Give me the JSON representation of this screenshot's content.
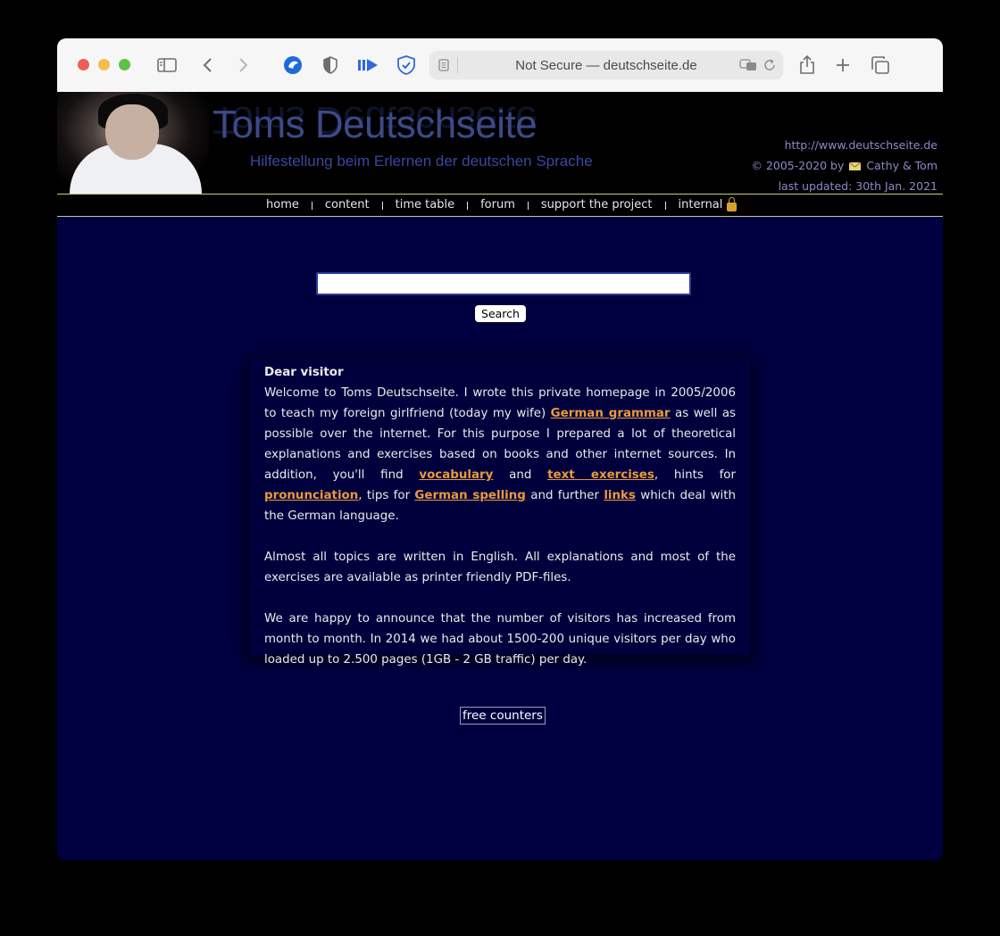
{
  "browser": {
    "address": "Not Secure — deutschseite.de",
    "traffic_lights": [
      "#ec5f56",
      "#f3bd4f",
      "#5ec245"
    ]
  },
  "header": {
    "title": "Toms Deutschseite",
    "subtitle": "Hilfestellung beim Erlernen der deutschen Sprache",
    "url": "http://www.deutschseite.de",
    "copyright_prefix": "© 2005-2020 by",
    "copyright_names": "Cathy & Tom",
    "last_updated": "last updated: 30th Jan. 2021"
  },
  "nav": {
    "items": [
      "home",
      "content",
      "time table",
      "forum",
      "support the project",
      "internal"
    ]
  },
  "search": {
    "value": "",
    "button_label": "Search"
  },
  "content": {
    "greeting": "Dear visitor",
    "p1": {
      "t1": "Welcome to Toms Deutschseite. I wrote this private homepage in 2005/2006 to teach my foreign girlfriend (today my wife) ",
      "link_grammar": "German grammar",
      "t2": " as well as possible over the internet. For this purpose I prepared a lot of theoretical explanations and exercises based on books and other internet sources. In addition, you'll find ",
      "link_vocabulary": "vocabulary",
      "t3": " and ",
      "link_text_exercises": "text exercises",
      "t4": ", hints for ",
      "link_pronunciation": "pronunciation",
      "t5": ", tips for ",
      "link_spelling": "German spelling",
      "t6": " and further ",
      "link_links": "links",
      "t7": " which deal with the German language."
    },
    "p2": "Almost all topics are written in English. All explanations and most of the exercises are available as printer friendly PDF-files.",
    "p3": "We are happy to announce that the number of visitors has increased from month to month. In 2014 we had about 1500-200 unique visitors per day who loaded up to 2.500 pages (1GB - 2 GB traffic) per day."
  },
  "footer": {
    "counter_label": "free counters"
  }
}
